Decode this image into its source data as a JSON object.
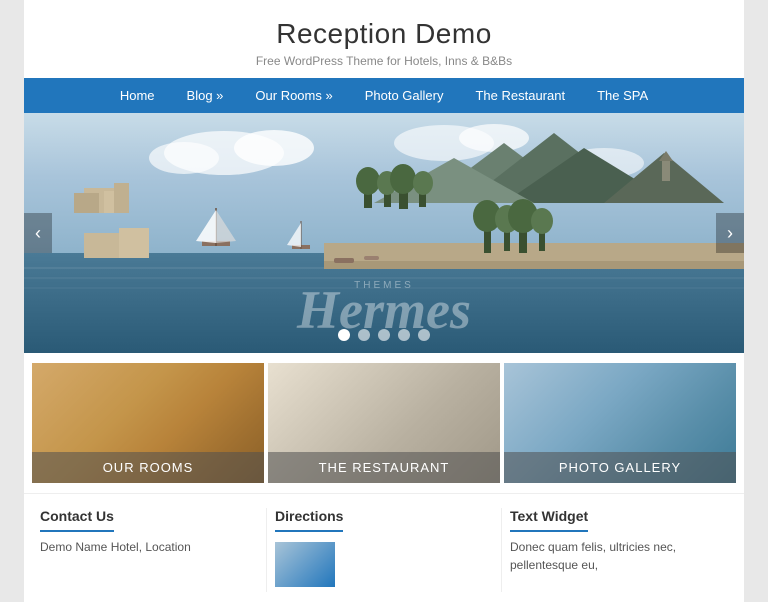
{
  "site": {
    "title": "Reception Demo",
    "subtitle": "Free WordPress Theme for Hotels, Inns & B&Bs"
  },
  "nav": {
    "items": [
      {
        "label": "Home",
        "has_submenu": false
      },
      {
        "label": "Blog »",
        "has_submenu": true
      },
      {
        "label": "Our Rooms »",
        "has_submenu": true
      },
      {
        "label": "Photo Gallery",
        "has_submenu": false
      },
      {
        "label": "The Restaurant",
        "has_submenu": false
      },
      {
        "label": "The SPA",
        "has_submenu": false
      }
    ]
  },
  "hero": {
    "watermark_themes": "THEMES",
    "watermark_hermes": "Hermes",
    "dots": [
      {
        "active": true
      },
      {
        "active": false
      },
      {
        "active": false
      },
      {
        "active": false
      },
      {
        "active": false
      }
    ],
    "arrow_left": "‹",
    "arrow_right": "›"
  },
  "feature_boxes": [
    {
      "label": "OUR ROOMS",
      "bg_class": "feature-box-bg-rooms"
    },
    {
      "label": "THE RESTAURANT",
      "bg_class": "feature-box-bg-restaurant"
    },
    {
      "label": "PHOTO GALLERY",
      "bg_class": "feature-box-bg-gallery"
    }
  ],
  "widgets": [
    {
      "title": "Contact Us",
      "content": "Demo Name Hotel, Location"
    },
    {
      "title": "Directions",
      "content": ""
    },
    {
      "title": "Text Widget",
      "content": "Donec quam felis, ultricies nec, pellentesque eu,"
    }
  ]
}
